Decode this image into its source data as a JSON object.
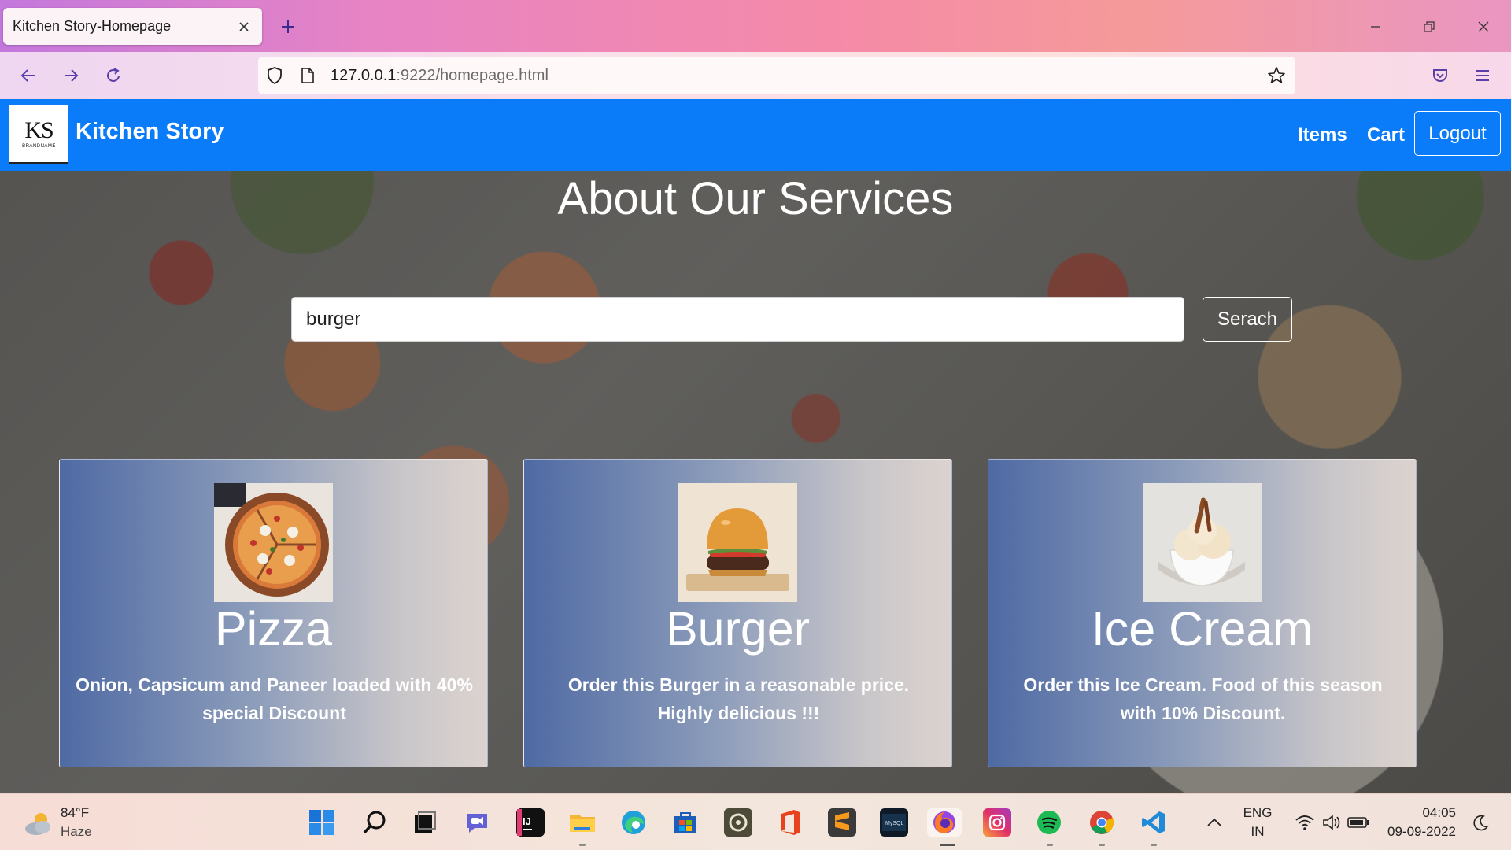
{
  "browser": {
    "tab_title": "Kitchen Story-Homepage",
    "url_host": "127.0.0.1",
    "url_path": ":9222/homepage.html"
  },
  "site": {
    "logo_text": "KS",
    "logo_subtext": "BRANDNAME",
    "brand": "Kitchen Story",
    "nav_items": [
      "Items",
      "Cart"
    ],
    "logout_label": "Logout",
    "nav_color": "#0a7cf9"
  },
  "main": {
    "heading": "About Our Services",
    "search_value": "burger",
    "search_button": "Serach"
  },
  "cards": [
    {
      "title": "Pizza",
      "description": "Onion, Capsicum and Paneer loaded with 40% special Discount",
      "image": "pizza-image"
    },
    {
      "title": "Burger",
      "description": "Order this Burger in a reasonable price. Highly delicious !!!",
      "image": "burger-image"
    },
    {
      "title": "Ice Cream",
      "description": "Order this Ice Cream. Food of this season with 10% Discount.",
      "image": "ice-cream-image"
    }
  ],
  "taskbar": {
    "weather_temp": "84°F",
    "weather_desc": "Haze",
    "lang_1": "ENG",
    "lang_2": "IN",
    "time": "04:05",
    "date": "09-09-2022"
  }
}
